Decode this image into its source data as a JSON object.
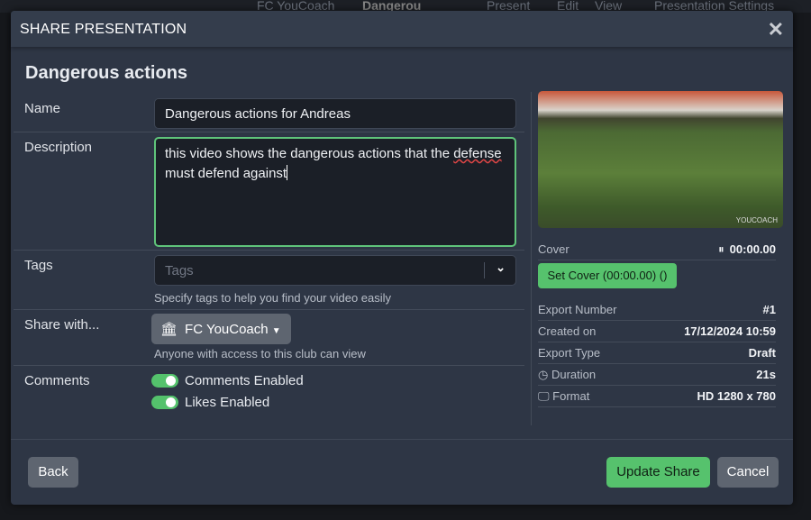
{
  "background": {
    "breadcrumb_club": "FC YouCoach",
    "breadcrumb_current": "Dangerou",
    "menu": [
      "Present",
      "Edit",
      "View",
      "Presentation Settings"
    ]
  },
  "modal": {
    "title": "SHARE PRESENTATION",
    "close_icon": "close-icon",
    "heading": "Dangerous actions"
  },
  "form": {
    "name_label": "Name",
    "name_value": "Dangerous actions for Andreas",
    "description_label": "Description",
    "description_value_a": "this video shows the dangerous actions that the ",
    "description_value_b": "defense",
    "description_value_c": " must defend against",
    "tags_label": "Tags",
    "tags_placeholder": "Tags",
    "tags_help": "Specify tags to help you find your video easily",
    "share_label": "Share with...",
    "share_value": "FC YouCoach",
    "share_help": "Anyone with access to this club can view",
    "comments_label": "Comments",
    "comments_toggle": "Comments Enabled",
    "comments_on": true,
    "likes_toggle": "Likes Enabled",
    "likes_on": true
  },
  "sidebar": {
    "watermark": "YOUCOACH",
    "cover_label": "Cover",
    "cover_time": "00:00.00",
    "set_cover": "Set Cover (00:00.00) ()",
    "details": [
      {
        "label": "Export Number",
        "value": "#1"
      },
      {
        "label": "Created on",
        "value": "17/12/2024 10:59"
      },
      {
        "label": "Export Type",
        "value": "Draft"
      },
      {
        "label": "Duration",
        "value": "21s",
        "icon": "clock-icon"
      },
      {
        "label": "Format",
        "value": "HD 1280 x 780",
        "icon": "monitor-icon"
      }
    ]
  },
  "footer": {
    "back": "Back",
    "update": "Update Share",
    "cancel": "Cancel"
  },
  "colors": {
    "accent": "#56c26d",
    "modal_bg": "#2e3645"
  }
}
